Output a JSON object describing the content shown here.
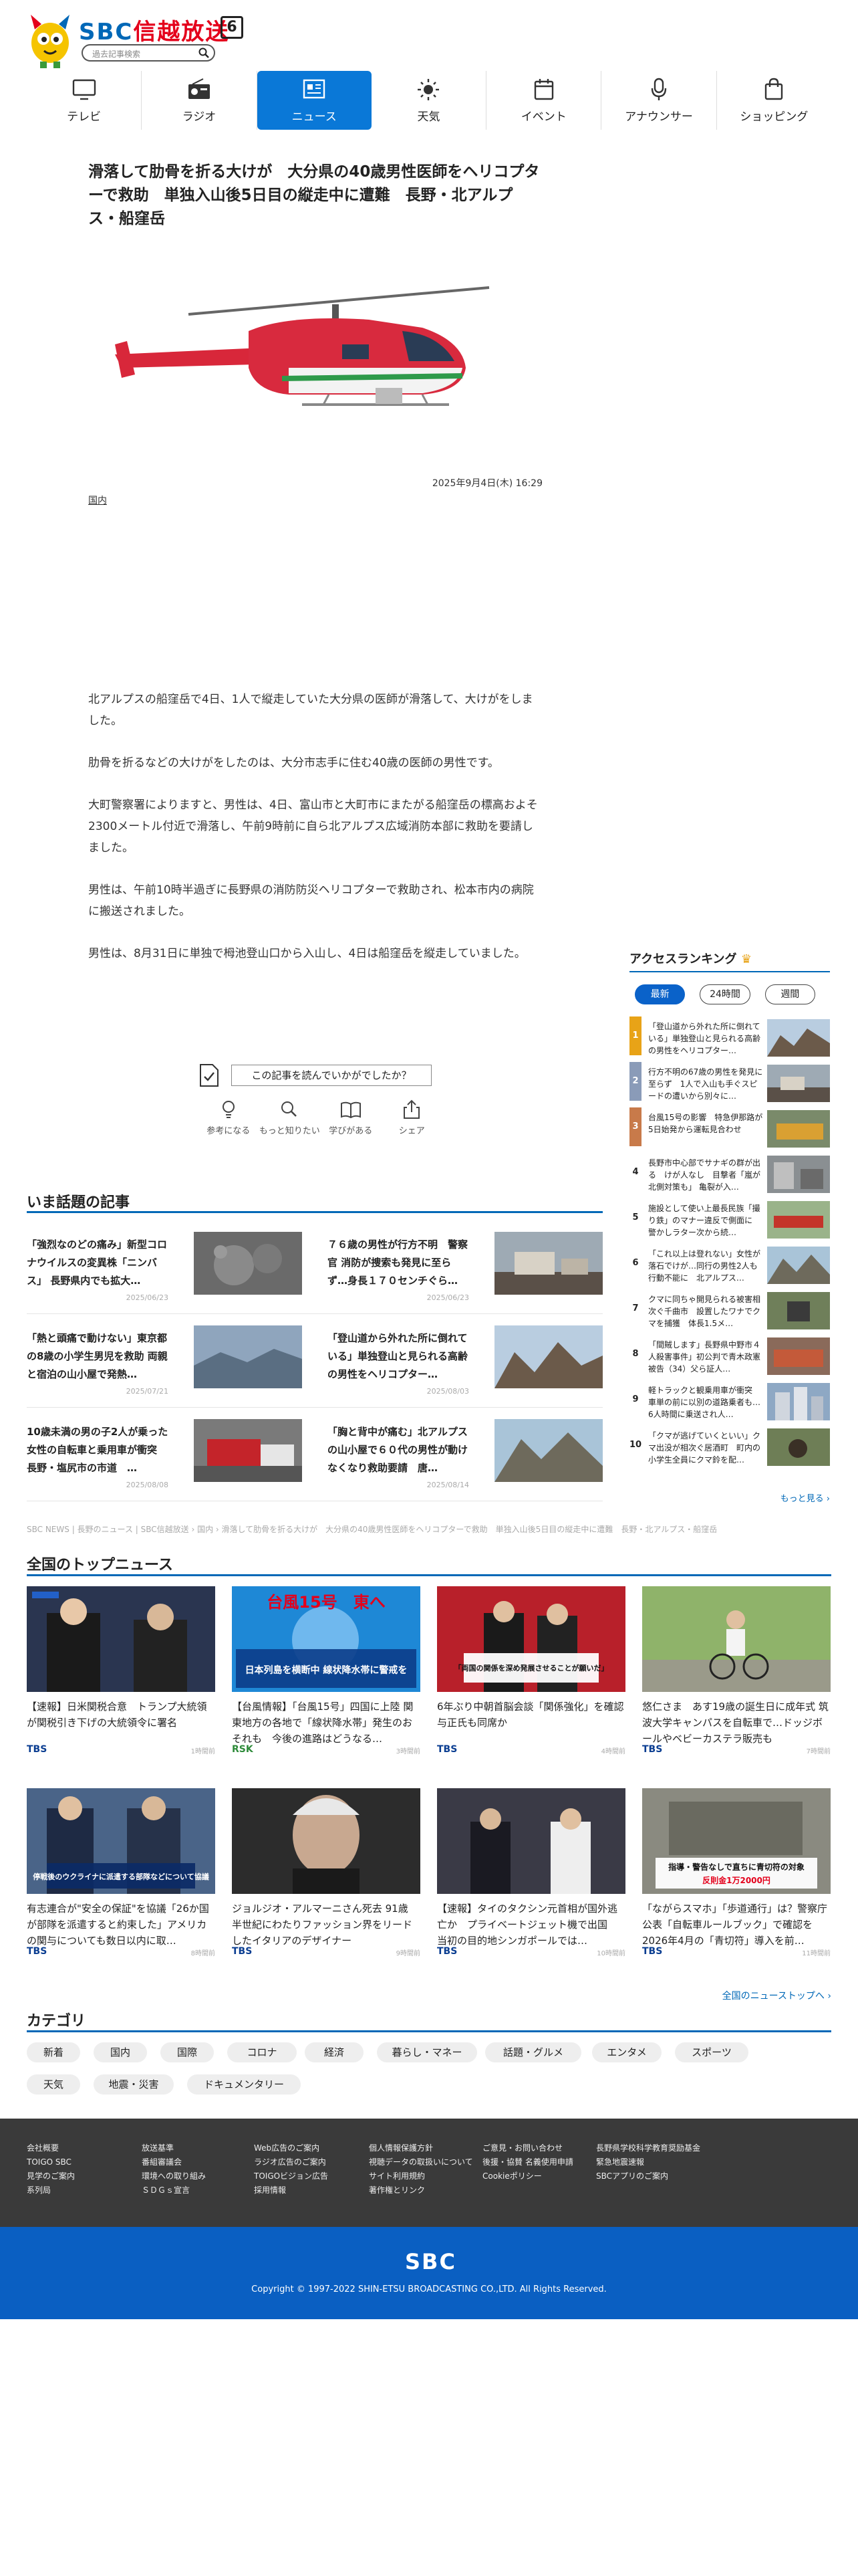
{
  "header": {
    "logo_brand": "SBC",
    "logo_name": "信越放送",
    "logo_channel": "6",
    "search_placeholder": "過去記事検索"
  },
  "nav": [
    {
      "label": "テレビ",
      "icon": "tv-icon"
    },
    {
      "label": "ラジオ",
      "icon": "radio-icon"
    },
    {
      "label": "ニュース",
      "icon": "news-icon",
      "active": true
    },
    {
      "label": "天気",
      "icon": "sun-icon"
    },
    {
      "label": "イベント",
      "icon": "calendar-icon"
    },
    {
      "label": "アナウンサー",
      "icon": "microphone-icon"
    },
    {
      "label": "ショッピング",
      "icon": "shopping-bag-icon"
    }
  ],
  "article": {
    "title": "滑落して肋骨を折る大けが　大分県の40歳男性医師をヘリコプターで救助　単独入山後5日目の縦走中に遭難　長野・北アルプス・船窪岳",
    "date": "2025年9月4日(木) 16:29",
    "category": "国内",
    "paragraphs": [
      "北アルプスの船窪岳で4日、1人で縦走していた大分県の医師が滑落して、大けがをしました。",
      "肋骨を折るなどの大けがをしたのは、大分市志手に住む40歳の医師の男性です。",
      "大町警察署によりますと、男性は、4日、富山市と大町市にまたがる船窪岳の標高およそ2300メートル付近で滑落し、午前9時前に自ら北アルプス広域消防本部に救助を要請しました。",
      "男性は、午前10時半過ぎに長野県の消防防災ヘリコプターで救助され、松本市内の病院に搬送されました。",
      "男性は、8月31日に単独で栂池登山口から入山し、4日は船窪岳を縦走していました。"
    ]
  },
  "reactions": {
    "question": "この記事を読んでいかがでしたか？",
    "items": [
      "参考になる",
      "もっと知りたい",
      "学びがある",
      "シェア"
    ]
  },
  "topics": {
    "title": "いま話題の記事",
    "items": [
      {
        "title": "「強烈なのどの痛み」新型コロナウイルスの変異株「ニンバス」 長野県内でも拡大…",
        "date": "2025/06/23"
      },
      {
        "title": "７６歳の男性が行方不明　警察官 消防が捜索も発見に至らず…身長１７０センチぐら…",
        "date": "2025/06/23"
      },
      {
        "title": "「熱と頭痛で動けない」東京都の8歳の小学生男児を救助 両親と宿泊の山小屋で発熱…",
        "date": "2025/07/21"
      },
      {
        "title": "「登山道から外れた所に倒れている」単独登山と見られる高齢の男性をヘリコプター…",
        "date": "2025/08/03"
      },
      {
        "title": "10歳未満の男の子2人が乗った女性の自転車と乗用車が衝突　長野・塩尻市の市道　…",
        "date": "2025/08/08"
      },
      {
        "title": "「胸と背中が痛む」北アルプスの山小屋で６０代の男性が動けなくなり救助要請　唐…",
        "date": "2025/08/14"
      }
    ]
  },
  "ranking": {
    "title": "アクセスランキング",
    "tabs": [
      "最新",
      "24時間",
      "週間"
    ],
    "items": [
      {
        "rank": "1",
        "title": "「登山道から外れた所に倒れている」単独登山と見られる高齢の男性をヘリコプター…"
      },
      {
        "rank": "2",
        "title": "行方不明の67歳の男性を発見に至らず　1人で入山も手ぐスピードの遭いから別々に…"
      },
      {
        "rank": "3",
        "title": "台風15号の影響　特急伊那路が5日始発から運転見合わせ"
      },
      {
        "rank": "4",
        "title": "長野市中心部でサナギの群が出る　けが人なし　目撃者「嵐が北側対策も」 亀裂が入…"
      },
      {
        "rank": "5",
        "title": "施設として使い上最長民族「撮り鉄」のマナー違反で側面に　警かしラター次から続…"
      },
      {
        "rank": "6",
        "title": "「これ以上は登れない」女性が落石でけが…同行の男性2人も行動不能に　北アルプス…"
      },
      {
        "rank": "7",
        "title": "クマに同ちゃ開見られる被害相次ぐ千曲市　設置したワナでクマを捕獲　体長1.5メ…"
      },
      {
        "rank": "8",
        "title": "「間賊します」長野県中野市４人殺害事件」初公判で青木政憲被告（34）父ら証人…"
      },
      {
        "rank": "9",
        "title": "軽トラックと観乗用車が衝突　車単の前に以別の道路乗者も…6人時間に乗送され人…"
      },
      {
        "rank": "10",
        "title": "「クマが逃げていくといい」クマ出没が相次ぐ居酒町　町内の小学生全員にクマ鈴を配…"
      }
    ],
    "more": "もっと見る"
  },
  "breadcrumb": "SBC NEWS | 長野のニュース | SBC信越放送 › 国内 › 滑落して肋骨を折る大けが　大分県の40歳男性医師をヘリコプターで救助　単独入山後5日目の縦走中に遭難　長野・北アルプス・船窪岳",
  "national": {
    "title": "全国のトップニュース",
    "items": [
      {
        "title": "【速報】日米関税合意　トランプ大統領が関税引き下げの大統領令に署名",
        "source": "TBS",
        "time": "1時間前"
      },
      {
        "title": "【台風情報】「台風15号」四国に上陸 関東地方の各地で「線状降水帯」発生のおそれも　今後の進路はどうなる…",
        "source": "RSK",
        "time": "3時間前"
      },
      {
        "title": "6年ぶり中朝首脳会談「関係強化」を確認　与正氏も同席か",
        "source": "TBS",
        "time": "4時間前"
      },
      {
        "title": "悠仁さま　あす19歳の誕生日に成年式 筑波大学キャンパスを自転車で…ドッジボールやベビーカステラ販売も",
        "source": "TBS",
        "time": "7時間前"
      },
      {
        "title": "有志連合が\"安全の保証\"を協議「26か国が部隊を派遣すると約束した」アメリカの関与についても数日以内に取…",
        "source": "TBS",
        "time": "8時間前"
      },
      {
        "title": "ジョルジオ・アルマーニさん死去 91歳 半世紀にわたりファッション界をリードしたイタリアのデザイナー",
        "source": "TBS",
        "time": "9時間前"
      },
      {
        "title": "【速報】タイのタクシン元首相が国外逃亡か　プライベートジェット機で出国　当初の目的地シンガポールでは…",
        "source": "TBS",
        "time": "10時間前"
      },
      {
        "title": "「ながらスマホ」「歩道通行」は？警察庁公表「自転車ルールブック」で確認を 2026年4月の「青切符」導入を前…",
        "source": "TBS",
        "time": "11時間前"
      }
    ],
    "more": "全国のニューストップへ",
    "thumb_texts": {
      "typhoon_top": "台風15号　東へ",
      "typhoon_bottom": "日本列島を横断中 線状降水帯に警戒を",
      "china_caption": "「両国の関係を深め発展させることが願いだ」",
      "ukraine_caption": "停戦後のウクライナに派遣する部隊などについて協議",
      "bike_caption": "指導・警告なしで直ちに青切符の対象",
      "bike_fine": "反則金1万2000円"
    }
  },
  "categories": {
    "title": "カテゴリ",
    "items": [
      "新着",
      "国内",
      "国際",
      "コロナ",
      "経済",
      "暮らし・マネー",
      "話題・グルメ",
      "エンタメ",
      "スポーツ",
      "天気",
      "地震・災害",
      "ドキュメンタリー"
    ]
  },
  "footer": {
    "columns": [
      [
        "会社概要",
        "TOIGO SBC",
        "見学のご案内",
        "系列局"
      ],
      [
        "放送基準",
        "番組審議会",
        "環境への取り組み",
        "ＳＤＧｓ宣言"
      ],
      [
        "Web広告のご案内",
        "ラジオ広告のご案内",
        "TOIGOビジョン広告",
        "採用情報"
      ],
      [
        "個人情報保護方針",
        "視聴データの取扱いについて",
        "サイト利用規約",
        "著作権とリンク"
      ],
      [
        "ご意見・お問い合わせ",
        "後援・協賛 名義使用申請",
        "Cookieポリシー"
      ],
      [
        "長野県学校科学教育奨励基金",
        "緊急地震速報",
        "SBCアプリのご案内"
      ]
    ],
    "logo": "SBC",
    "copyright": "Copyright © 1997-2022 SHIN-ETSU BROADCASTING CO.,LTD. All Rights Reserved."
  },
  "colors": {
    "brand_blue": "#0068b7",
    "nav_active": "#0a78d7",
    "brand_red": "#e4001b",
    "footer_dark": "#3a3a3a",
    "footer_blue": "#0a5fc2"
  }
}
